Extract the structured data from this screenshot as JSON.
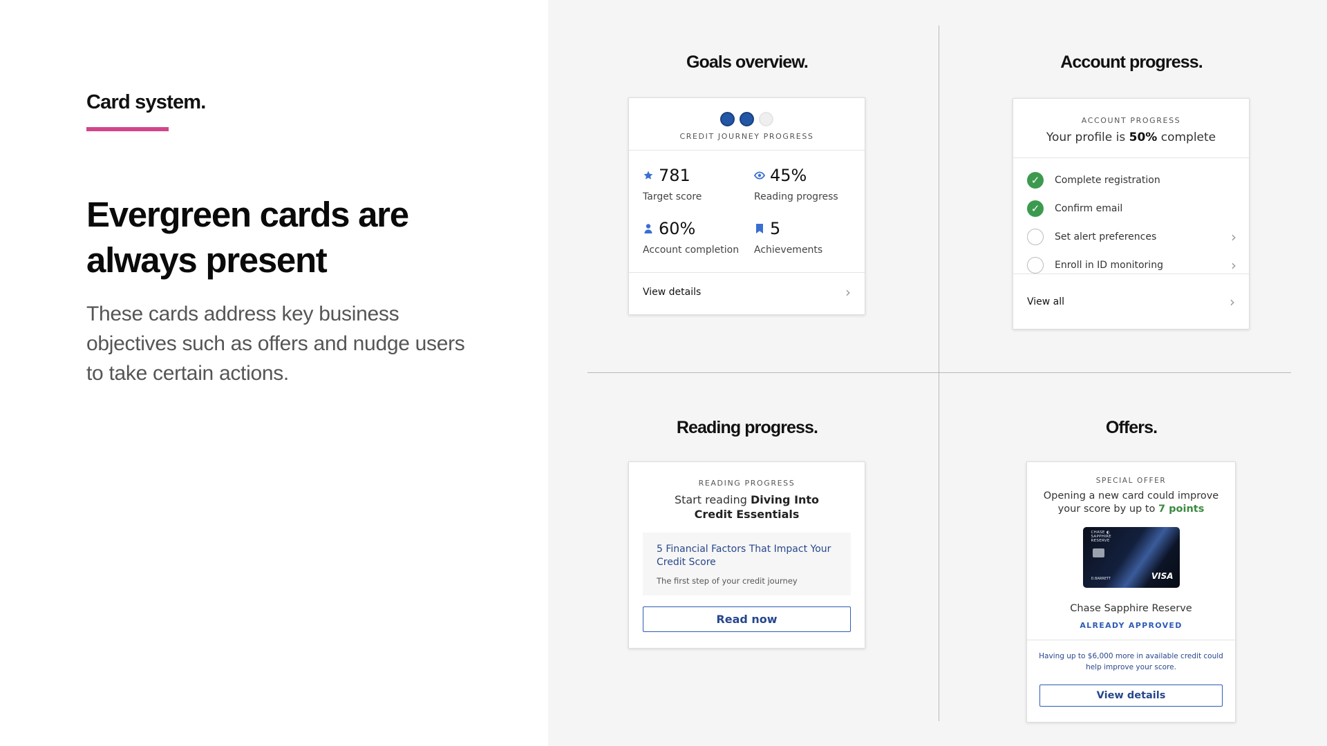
{
  "left": {
    "section_title": "Card system.",
    "headline": "Evergreen cards are always present",
    "description": "These cards address key business objectives such as offers and nudge users to take certain actions.",
    "accent_color": "#d2458a"
  },
  "quadrants": {
    "goals": {
      "title": "Goals overview.",
      "card": {
        "eyebrow": "CREDIT JOURNEY PROGRESS",
        "progress_dots_filled": 2,
        "progress_dots_total": 3,
        "stats": [
          {
            "icon": "star-icon",
            "value": "781",
            "label": "Target score"
          },
          {
            "icon": "eye-icon",
            "value": "45%",
            "label": "Reading progress"
          },
          {
            "icon": "person-icon",
            "value": "60%",
            "label": "Account completion"
          },
          {
            "icon": "bookmark-icon",
            "value": "5",
            "label": "Achievements"
          }
        ],
        "footer_link": "View details"
      }
    },
    "account": {
      "title": "Account progress.",
      "card": {
        "eyebrow": "ACCOUNT PROGRESS",
        "summary_prefix": "Your profile is ",
        "summary_value": "50%",
        "summary_suffix": " complete",
        "tasks": [
          {
            "label": "Complete registration",
            "done": true
          },
          {
            "label": "Confirm email",
            "done": true
          },
          {
            "label": "Set alert preferences",
            "done": false
          },
          {
            "label": "Enroll in ID monitoring",
            "done": false
          }
        ],
        "footer_link": "View all"
      }
    },
    "reading": {
      "title": "Reading progress.",
      "card": {
        "eyebrow": "READING PROGRESS",
        "sub_prefix": "Start reading ",
        "sub_bold_1": "Diving Into",
        "sub_bold_2": "Credit Essentials",
        "article_title": "5 Financial Factors That Impact Your Credit Score",
        "article_desc": "The first step of your credit journey",
        "button": "Read now"
      }
    },
    "offers": {
      "title": "Offers.",
      "card": {
        "eyebrow": "SPECIAL OFFER",
        "body_prefix": "Opening a new card could improve your score by up to ",
        "body_points": "7 points",
        "card_brand_line1": "CHASE ◐",
        "card_brand_line2": "SAPPHIRE",
        "card_brand_line3": "RESERVE",
        "card_holder": "D.BARRETT",
        "card_network": "VISA",
        "product_name": "Chase Sapphire Reserve",
        "badge": "ALREADY APPROVED",
        "note": "Having up to $6,000 more in available credit could help improve your score.",
        "button": "View details"
      }
    }
  },
  "colors": {
    "link_blue": "#27478c",
    "button_blue": "#2e5bb5",
    "success_green": "#3c9a4f",
    "panel_bg": "#f5f5f5"
  }
}
